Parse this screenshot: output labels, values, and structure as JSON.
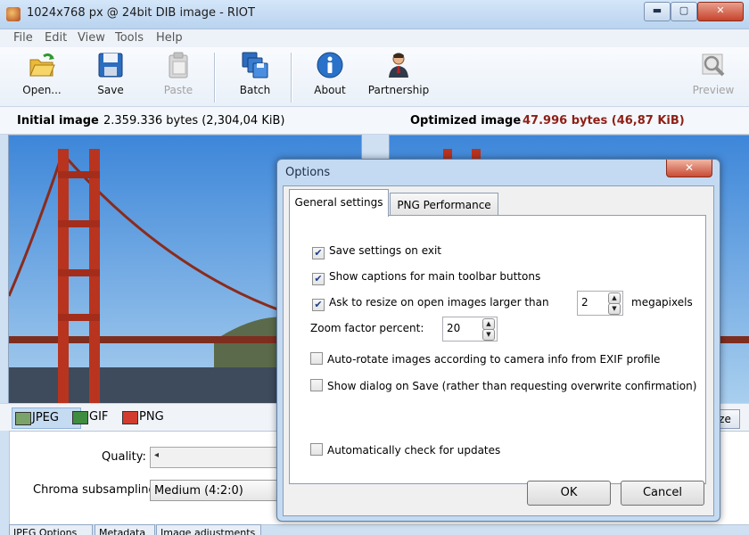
{
  "window": {
    "title": "1024x768 px @ 24bit  DIB image - RIOT",
    "minimize": "▬",
    "maximize": "▢",
    "close": "✕"
  },
  "menu": {
    "items": [
      "File",
      "Edit",
      "View",
      "Tools",
      "Help"
    ]
  },
  "toolbar": {
    "open": "Open...",
    "save": "Save",
    "paste": "Paste",
    "batch": "Batch",
    "about": "About",
    "partnership": "Partnership",
    "preview": "Preview"
  },
  "info": {
    "initial_label": "Initial image",
    "initial_bytes": "2.359.336 bytes (2,304,04 KiB)",
    "optimized_label": "Optimized image",
    "optimized_bytes": "47.996 bytes (46,87 KiB)"
  },
  "format_tabs": {
    "jpeg": "JPEG",
    "gif": "GIF",
    "png": "PNG",
    "resize_fragment": "ze"
  },
  "jpeg_panel": {
    "quality_label": "Quality:",
    "chroma_label": "Chroma subsampling:",
    "chroma_value": "Medium (4:2:0)",
    "bottom_tabs": [
      "JPEG Options",
      "Metadata",
      "Image adjustments"
    ]
  },
  "dialog": {
    "title": "Options",
    "close": "✕",
    "tabs": {
      "general": "General settings",
      "png": "PNG Performance"
    },
    "options": {
      "save_on_exit": {
        "label": "Save settings on exit",
        "checked": "✔"
      },
      "show_captions": {
        "label": "Show captions for main toolbar buttons",
        "checked": "✔"
      },
      "ask_resize": {
        "label": "Ask to resize on open images larger than",
        "checked": "✔"
      },
      "megapixels_value": "2",
      "megapixels_unit": "megapixels",
      "zoom_label": "Zoom factor percent:",
      "zoom_value": "20",
      "auto_rotate": {
        "label": "Auto-rotate images according to camera info from EXIF profile",
        "checked": ""
      },
      "show_dialog_save": {
        "label": "Show dialog on Save (rather than requesting overwrite confirmation)",
        "checked": ""
      },
      "auto_update": {
        "label": "Automatically check for updates",
        "checked": ""
      }
    },
    "ok": "OK",
    "cancel": "Cancel"
  },
  "colors": {
    "optimized_bytes": "#8f1f16",
    "selected_tab": "#c5dbf2"
  }
}
